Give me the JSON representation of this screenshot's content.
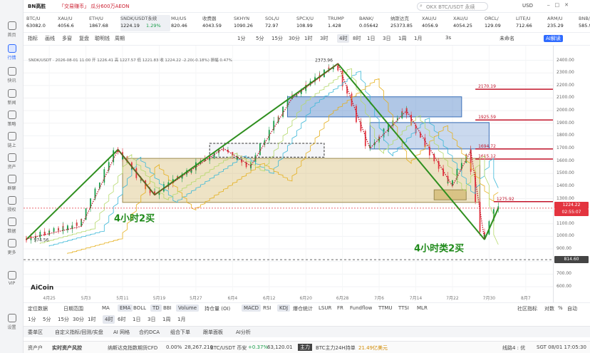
{
  "app": {
    "title": "BN高胜",
    "banner": "「交易赚币」 瓜分600万AEON",
    "search_placeholder": "OKX BTC/USDT 永续",
    "currency": "USD"
  },
  "sidebar": [
    {
      "label": "首页"
    },
    {
      "label": "行情"
    },
    {
      "label": "快讯"
    },
    {
      "label": "新闻"
    },
    {
      "label": "策略"
    },
    {
      "label": "链上"
    },
    {
      "label": "资产"
    },
    {
      "label": "群聊"
    },
    {
      "label": "授权"
    },
    {
      "label": "数据"
    },
    {
      "label": "更多"
    },
    {
      "label": "VIP"
    },
    {
      "label": "设置"
    }
  ],
  "tickers": [
    {
      "name": "BTC/U",
      "price": "63082.0"
    },
    {
      "name": "XAU/U",
      "price": "4056.6"
    },
    {
      "name": "ETH/U",
      "price": "1867.68"
    },
    {
      "name": "SNDK/USDT永续",
      "price": "1224.19",
      "change": "1.29%"
    },
    {
      "name": "MU/US",
      "price": "820.46"
    },
    {
      "name": "收费器",
      "price": "4043.59"
    },
    {
      "name": "SKHYN",
      "price": "1090.26"
    },
    {
      "name": "SOL/U",
      "price": "72.97"
    },
    {
      "name": "SPCX/U",
      "price": "108.99"
    },
    {
      "name": "TRUMP",
      "price": "1.428"
    },
    {
      "name": "BANK/",
      "price": "0.05642"
    },
    {
      "name": "纳斯达克",
      "price": "25373.85"
    },
    {
      "name": "XAU/U",
      "price": "4056.9"
    },
    {
      "name": "XAU/U",
      "price": "4054.25"
    },
    {
      "name": "ORCL/",
      "price": "129.09"
    },
    {
      "name": "LITE/U",
      "price": "712.66"
    },
    {
      "name": "ARM/U",
      "price": "235.29"
    },
    {
      "name": "BNB/U",
      "price": "585.90"
    }
  ],
  "toolbar": {
    "items": [
      "指标",
      "画线",
      "多窗",
      "复盘",
      "聪明钱",
      "周期",
      "1分",
      "5分",
      "15分",
      "30分",
      "1时",
      "3时",
      "4时",
      "8时",
      "1日",
      "3日",
      "1周",
      "1月"
    ],
    "active": "4时",
    "right": [
      "3s",
      "未命名",
      "AI解读"
    ]
  },
  "legend": "SNDK/USDT · 2026-08-01 11:00 开 1226.41 高 1227.57 低 1221.83 收 1224.22 -2.20(-0.18%) 振幅 0.47%",
  "chart_labels": {
    "wave_buy": "4小时2买",
    "wave_buy2": "4小时类2买",
    "logo": "AiCoin",
    "low_label": "974.56",
    "high_label": "2373.96"
  },
  "levels": [
    {
      "value": "2170.19",
      "color": "#c2142a"
    },
    {
      "value": "1925.59",
      "color": "#c2142a"
    },
    {
      "value": "1694.72",
      "color": "#c2142a"
    },
    {
      "value": "1615.12",
      "color": "#c2142a"
    },
    {
      "value": "1275.92",
      "color": "#c2142a"
    }
  ],
  "price_axis": [
    "2400.00",
    "2300.00",
    "2200.00",
    "2100.00",
    "2000.00",
    "1900.00",
    "1800.00",
    "1700.00",
    "1600.00",
    "1500.00",
    "1400.00",
    "1300.00",
    "1200.00",
    "1100.00",
    "1000.00",
    "900.00",
    "800.00",
    "700.00",
    "600.00"
  ],
  "price_tags": {
    "last": "1224.22",
    "countdown": "02:55:07",
    "cross": "814.60"
  },
  "date_axis": [
    "4月25",
    "5月3",
    "5月11",
    "5月19",
    "5月27",
    "6月4",
    "6月12",
    "6月20",
    "6月28",
    "7月6",
    "7月14",
    "7月22",
    "7月30",
    "8月7",
    "8月"
  ],
  "date_tag": "2026-08-20 08:00",
  "bottom_periods": [
    "1日",
    "5日",
    "15日",
    "30日",
    "3个月",
    "6个月",
    "1年",
    "3年",
    "全部"
  ],
  "bottom1": {
    "left": [
      "定位数据",
      "日期范围"
    ],
    "indicators": [
      "MA",
      "EMA",
      "BOLL",
      "TD",
      "BBI",
      "Volume",
      "持仓量 (OI)",
      "MACD",
      "RSI",
      "KDJ",
      "爆仓统计",
      "LSUR",
      "FR",
      "Fundflow",
      "TTMU",
      "TTSI",
      "MLR"
    ],
    "active": [
      "EMA",
      "TD",
      "Volume",
      "MACD",
      "KDJ"
    ],
    "right": [
      "社区指标",
      "对数",
      "%",
      "自动"
    ]
  },
  "bottom2": {
    "periods": [
      "1分",
      "5分",
      "15分",
      "30分",
      "1时",
      "4时",
      "6时",
      "1日",
      "3日",
      "1周",
      "1月"
    ],
    "active": "4时"
  },
  "tabs": [
    "委单区",
    "自定义指标/回测/实盘",
    "AI 网格",
    "合约DCA",
    "组合下单",
    "跟单面板",
    "AI分析"
  ],
  "status": {
    "asset": "资产户",
    "risk": "实时资产风控",
    "cfd": "纳斯达克指数期货CFD",
    "cfd_change": "0.00%",
    "cfd_price": "28,267.210",
    "btc": "BTC/USDT 币安",
    "btc_change": "+0.37%",
    "btc_price": "63,120.01",
    "main": "主力",
    "main_text": "BTC主力24H持单",
    "main_val": "21.49亿美元",
    "line": "线路4 : 优",
    "time": "SGT 08/01 17:05:30"
  },
  "chart_data": {
    "type": "candlestick",
    "symbol": "SNDK/USDT",
    "interval": "4时",
    "x_range": [
      "2026-04-20",
      "2026-08-10"
    ],
    "ylim": [
      600,
      2500
    ],
    "last_price": 1224.22,
    "swing_points": [
      {
        "date": "2026-04-20",
        "price": 974.56
      },
      {
        "date": "2026-05-10",
        "price": 1690
      },
      {
        "date": "2026-05-18",
        "price": 1320
      },
      {
        "date": "2026-06-27",
        "price": 2373.96
      },
      {
        "date": "2026-07-28",
        "price": 970
      },
      {
        "date": "2026-08-01",
        "price": 1224.22
      }
    ],
    "levels": [
      2170.19,
      1925.59,
      1694.72,
      1615.12,
      1275.92
    ]
  }
}
